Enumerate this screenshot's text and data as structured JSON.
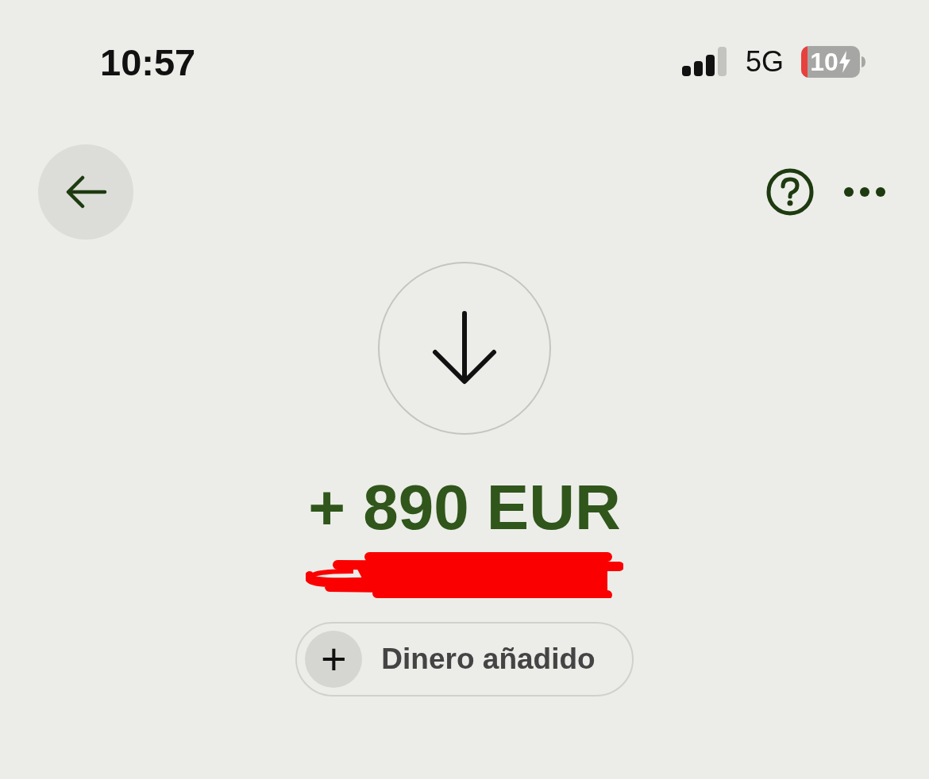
{
  "status_bar": {
    "time": "10:57",
    "network": "5G",
    "battery": "10"
  },
  "transaction": {
    "amount": "+ 890 EUR",
    "category": {
      "icon": "+",
      "label": "Dinero añadido"
    }
  }
}
